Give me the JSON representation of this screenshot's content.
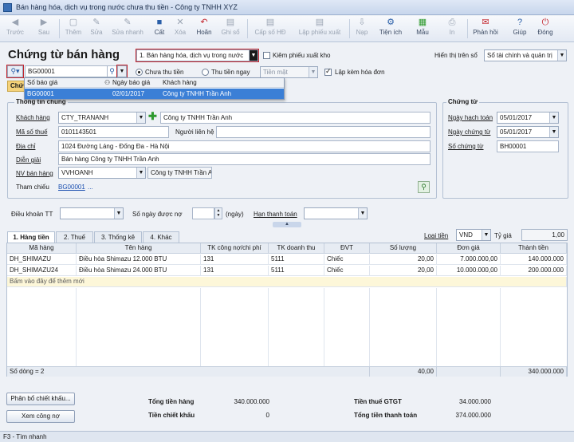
{
  "window": {
    "title": "Bán hàng hóa, dịch vụ trong nước chưa thu tiền - Công ty TNHH XYZ"
  },
  "toolbar": {
    "prev": "Trước",
    "next": "Sau",
    "add": "Thêm",
    "edit": "Sửa",
    "quick_edit": "Sửa nhanh",
    "save": "Cất",
    "delete": "Xóa",
    "undo": "Hoãn",
    "post": "Ghi sổ",
    "post_invoice": "Cấp số HĐ",
    "make_delivery": "Lập phiếu xuất",
    "load": "Nạp",
    "utilities": "Tiện ích",
    "template": "Mẫu",
    "print": "In",
    "feedback": "Phản hồi",
    "help": "Giúp",
    "close": "Đóng"
  },
  "header": {
    "title": "Chứng từ bán hàng",
    "transaction_type": "1. Bán hàng hóa, dịch vụ trong nước",
    "delivery_note_label": "Kiêm phiếu xuất kho",
    "display_ledger_label": "Hiển thị trên sổ",
    "display_ledger_value": "Sổ tài chính và quản trị",
    "ref_input": "BG00001",
    "unpaid_label": "Chưa thu tiền",
    "paid_label": "Thu tiền ngay",
    "cash_value": "Tiền mặt",
    "with_invoice_label": "Lập kèm hóa đơn",
    "tab_chung_tu": "Chứng"
  },
  "popup": {
    "col_number": "Số báo giá",
    "col_date": "Ngày báo giá",
    "col_customer": "Khách hàng",
    "row": {
      "number": "BG00001",
      "date": "02/01/2017",
      "customer": "Công ty TNHH Trần Anh"
    }
  },
  "general_info": {
    "group_title": "Thông tin chung",
    "customer_label": "Khách hàng",
    "customer_code": "CTY_TRANANH",
    "customer_name": "Công ty TNHH Trần Anh",
    "tax_code_label": "Mã số thuế",
    "tax_code": "0101143501",
    "contact_label": "Người liên hệ",
    "contact": "",
    "address_label": "Địa chỉ",
    "address": "1024 Đường Láng - Đống Đa - Hà Nội",
    "description_label": "Diễn giải",
    "description": "Bán hàng Công ty TNHH Trần Anh",
    "salesperson_label": "NV bán hàng",
    "salesperson_code": "VVHOANH",
    "salesperson_name": "Công ty TNHH Trần Anh",
    "reference_label": "Tham chiếu",
    "reference_link": "BG00001",
    "reference_more": "..."
  },
  "voucher": {
    "group_title": "Chứng từ",
    "posting_date_label": "Ngày hạch toán",
    "posting_date": "05/01/2017",
    "voucher_date_label": "Ngày chứng từ",
    "voucher_date": "05/01/2017",
    "voucher_no_label": "Số chứng từ",
    "voucher_no": "BH00001"
  },
  "terms": {
    "payment_terms_label": "Điều khoản TT",
    "credit_days_label": "Số ngày được nợ",
    "credit_days_unit": "(ngày)",
    "due_date_label": "Hạn thanh toán"
  },
  "currency": {
    "label": "Loại tiền",
    "value": "VND",
    "rate_label": "Tỷ giá",
    "rate": "1,00"
  },
  "tabs": [
    {
      "label": "1. Hàng tiền"
    },
    {
      "label": "2. Thuế"
    },
    {
      "label": "3. Thống kê"
    },
    {
      "label": "4. Khác"
    }
  ],
  "grid": {
    "columns": [
      "Mã hàng",
      "Tên hàng",
      "TK công nợ/chi phí",
      "TK doanh thu",
      "ĐVT",
      "Số lượng",
      "Đơn giá",
      "Thành tiền"
    ],
    "rows": [
      [
        "DH_SHIMAZU",
        "Điều hòa Shimazu 12.000 BTU",
        "131",
        "5111",
        "Chiếc",
        "20,00",
        "7.000.000,00",
        "140.000.000"
      ],
      [
        "DH_SHIMAZU24",
        "Điều hòa Shimazu 24.000 BTU",
        "131",
        "5111",
        "Chiếc",
        "20,00",
        "10.000.000,00",
        "200.000.000"
      ]
    ],
    "new_row_hint": "Bấm vào đây để thêm mới",
    "footer": {
      "row_count": "Số dòng = 2",
      "qty_total": "40,00",
      "amount_total": "340.000.000"
    }
  },
  "bottom": {
    "allocate_discount_button": "Phân bổ chiết khấu...",
    "view_debt_button": "Xem công nợ",
    "total_goods_label": "Tổng tiền hàng",
    "total_goods": "340.000.000",
    "discount_label": "Tiền chiết khấu",
    "discount": "0",
    "vat_label": "Tiền thuế GTGT",
    "vat": "34.000.000",
    "grand_total_label": "Tổng tiền thanh toán",
    "grand_total": "374.000.000"
  },
  "status": {
    "text": "F3 - Tìm nhanh"
  },
  "colors": {
    "accent": "#3b7fd6",
    "highlight_red": "#c3232b",
    "link": "#1a4fb0"
  }
}
